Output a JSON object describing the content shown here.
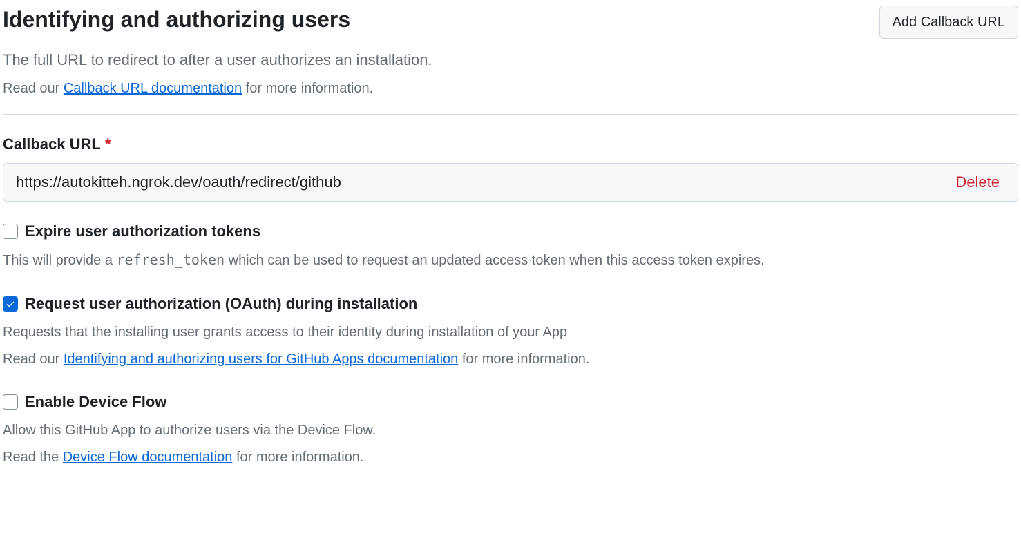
{
  "header": {
    "title": "Identifying and authorizing users",
    "addButton": "Add Callback URL",
    "subtitle": "The full URL to redirect to after a user authorizes an installation.",
    "readPrefix": "Read our ",
    "docLink": "Callback URL documentation",
    "readSuffix": " for more information."
  },
  "callback": {
    "label": "Callback URL",
    "value": "https://autokitteh.ngrok.dev/oauth/redirect/github",
    "deleteLabel": "Delete"
  },
  "expire": {
    "label": "Expire user authorization tokens",
    "checked": false,
    "descPrefix": "This will provide a ",
    "code": "refresh_token",
    "descSuffix": " which can be used to request an updated access token when this access token expires."
  },
  "oauth": {
    "label": "Request user authorization (OAuth) during installation",
    "checked": true,
    "desc": "Requests that the installing user grants access to their identity during installation of your App",
    "readPrefix": "Read our ",
    "docLink": "Identifying and authorizing users for GitHub Apps documentation",
    "readSuffix": " for more information."
  },
  "deviceFlow": {
    "label": "Enable Device Flow",
    "checked": false,
    "desc": "Allow this GitHub App to authorize users via the Device Flow.",
    "readPrefix": "Read the ",
    "docLink": "Device Flow documentation",
    "readSuffix": " for more information."
  }
}
